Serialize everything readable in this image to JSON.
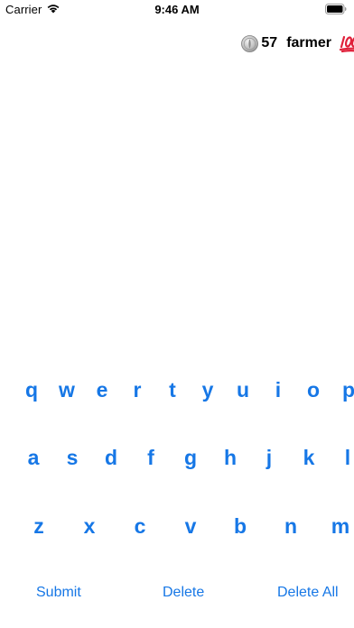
{
  "status_bar": {
    "carrier": "Carrier",
    "time": "9:46 AM"
  },
  "header": {
    "coin_icon": "silver-coin-icon",
    "coin_count": "57",
    "word": "farmer",
    "badge_icon": "hundred-points-icon"
  },
  "keyboard": {
    "row1": [
      "q",
      "w",
      "e",
      "r",
      "t",
      "y",
      "u",
      "i",
      "o",
      "p"
    ],
    "row2": [
      "a",
      "s",
      "d",
      "f",
      "g",
      "h",
      "j",
      "k",
      "l"
    ],
    "row3": [
      "z",
      "x",
      "c",
      "v",
      "b",
      "n",
      "m"
    ]
  },
  "actions": {
    "submit": "Submit",
    "delete": "Delete",
    "delete_all": "Delete All"
  },
  "colors": {
    "accent": "#1677e6",
    "text": "#000000",
    "background": "#ffffff"
  }
}
